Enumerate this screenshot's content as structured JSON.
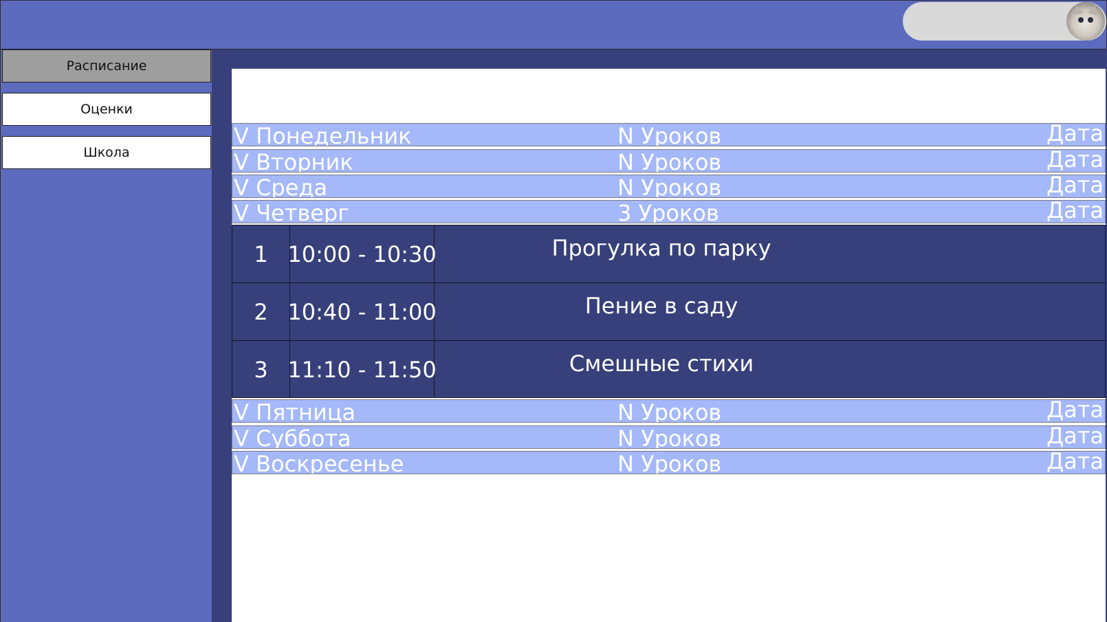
{
  "sidebar": {
    "items": [
      {
        "label": "Расписание",
        "active": true
      },
      {
        "label": "Оценки",
        "active": false
      },
      {
        "label": "Школа",
        "active": false
      }
    ]
  },
  "schedule": {
    "days": [
      {
        "name": "V Понедельник",
        "lessons": "N Уроков",
        "date": "Дата"
      },
      {
        "name": "V Вторник",
        "lessons": "N Уроков",
        "date": "Дата"
      },
      {
        "name": "V Среда",
        "lessons": "N Уроков",
        "date": "Дата"
      },
      {
        "name": "V Четверг",
        "lessons": "3 Уроков",
        "date": "Дата"
      },
      {
        "name": "V Пятница",
        "lessons": "N Уроков",
        "date": "Дата"
      },
      {
        "name": "V Суббота",
        "lessons": "N Уроков",
        "date": "Дата"
      },
      {
        "name": "V Воскресенье",
        "lessons": "N Уроков",
        "date": "Дата"
      }
    ],
    "expanded_day_lessons": [
      {
        "num": "1",
        "time": "10:00 - 10:30",
        "subject": "Прогулка по парку"
      },
      {
        "num": "2",
        "time": "10:40 - 11:00",
        "subject": "Пение в саду"
      },
      {
        "num": "3",
        "time": "11:10 - 11:50",
        "subject": "Смешные стихи"
      }
    ]
  },
  "colors": {
    "header": "#5c6bbe",
    "frame": "#37407a",
    "day_row": "#a5b8f9",
    "nav_active": "#9e9e9e"
  },
  "icons": {
    "avatar": "cat-avatar-icon"
  }
}
